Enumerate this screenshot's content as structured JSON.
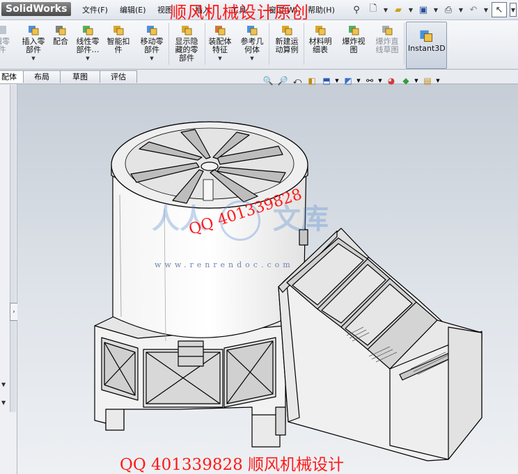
{
  "app": {
    "logo": "SolidWorks",
    "menus": [
      "文件(F)",
      "编辑(E)",
      "视图",
      "插入",
      "工具",
      "窗口(W)",
      "帮助(H)"
    ],
    "overlay_title": "顺风机械设计原创"
  },
  "commands": [
    {
      "label": "插入零\n部件",
      "icon": "insert-component-icon",
      "has_menu": true
    },
    {
      "label": "配合",
      "icon": "mate-icon",
      "has_menu": false
    },
    {
      "label": "线性零\n部件…",
      "icon": "linear-pattern-icon",
      "has_menu": true
    },
    {
      "label": "智能扣\n件",
      "icon": "smart-fastener-icon",
      "has_menu": false
    },
    {
      "label": "移动零\n部件",
      "icon": "move-component-icon",
      "has_menu": true
    },
    {
      "label": "显示隐\n藏的零\n部件",
      "icon": "show-hidden-icon",
      "has_menu": false
    },
    {
      "label": "装配体\n特征",
      "icon": "assembly-feature-icon",
      "has_menu": true
    },
    {
      "label": "参考几\n何体",
      "icon": "reference-geometry-icon",
      "has_menu": true
    },
    {
      "label": "新建运\n动算例",
      "icon": "motion-study-icon",
      "has_menu": false
    },
    {
      "label": "材料明\n细表",
      "icon": "bom-icon",
      "has_menu": false
    },
    {
      "label": "爆炸视\n图",
      "icon": "exploded-view-icon",
      "has_menu": false
    },
    {
      "label": "爆炸直\n线草图",
      "icon": "explode-line-icon",
      "has_menu": false,
      "disabled": true
    },
    {
      "label": "Instant3D",
      "icon": "instant3d-icon",
      "has_menu": false
    }
  ],
  "partial_left_command": "辑零\n件",
  "tabs": [
    "配体",
    "布局",
    "草图",
    "评估"
  ],
  "watermarks": {
    "qq": "QQ 401339828",
    "site": "www.renrendoc.com",
    "logo_chars": [
      "人人",
      "文库"
    ],
    "bottom_caption": "QQ 401339828 顺风机械设计"
  },
  "colors": {
    "accent_red": "#ff1a1a",
    "model_face": "#e9e9e9",
    "viewport_top": "#c6cdd6"
  }
}
